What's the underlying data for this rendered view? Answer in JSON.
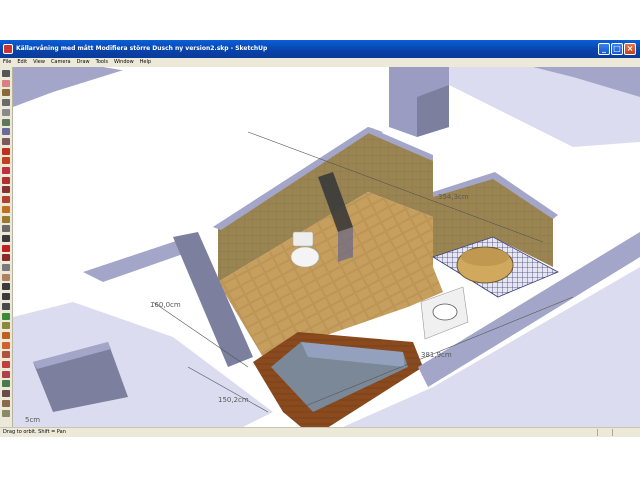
{
  "window": {
    "title": "Källarvåning med mått Modifiera större Dusch ny version2.skp - SketchUp",
    "controls": {
      "minimize": "_",
      "maximize": "□",
      "close": "×"
    }
  },
  "menu": [
    "File",
    "Edit",
    "View",
    "Camera",
    "Draw",
    "Tools",
    "Window",
    "Help"
  ],
  "toolbar": {
    "tools": [
      {
        "name": "select-icon",
        "color": "#555555"
      },
      {
        "name": "eraser-icon",
        "color": "#d98080"
      },
      {
        "name": "rectangle-icon",
        "color": "#8a6a3a"
      },
      {
        "name": "line-icon",
        "color": "#6a6a6a"
      },
      {
        "name": "circle-icon",
        "color": "#8a8a8a"
      },
      {
        "name": "arc-icon",
        "color": "#5a7a5a"
      },
      {
        "name": "polygon-icon",
        "color": "#6a6a9a"
      },
      {
        "name": "freehand-icon",
        "color": "#7a5a5a"
      },
      {
        "name": "move-icon",
        "color": "#c03020"
      },
      {
        "name": "push-pull-icon",
        "color": "#c04020"
      },
      {
        "name": "rotate-icon",
        "color": "#c03040"
      },
      {
        "name": "follow-me-icon",
        "color": "#b03030"
      },
      {
        "name": "scale-icon",
        "color": "#8a3030"
      },
      {
        "name": "offset-icon",
        "color": "#b04030"
      },
      {
        "name": "tape-measure-icon",
        "color": "#c07020"
      },
      {
        "name": "dimension-icon",
        "color": "#9a7a30"
      },
      {
        "name": "protractor-icon",
        "color": "#6a6a6a"
      },
      {
        "name": "text-icon",
        "color": "#3a3a3a"
      },
      {
        "name": "axes-icon",
        "color": "#c02020"
      },
      {
        "name": "3d-text-icon",
        "color": "#8a2a2a"
      },
      {
        "name": "orbit-icon",
        "color": "#7a7a7a"
      },
      {
        "name": "pan-icon",
        "color": "#b08060"
      },
      {
        "name": "zoom-icon",
        "color": "#3a3a3a"
      },
      {
        "name": "zoom-window-icon",
        "color": "#3a3a3a"
      },
      {
        "name": "zoom-extents-icon",
        "color": "#4a4a4a"
      },
      {
        "name": "previous-view-icon",
        "color": "#3a8a3a"
      },
      {
        "name": "next-view-icon",
        "color": "#8a8a3a"
      },
      {
        "name": "position-camera-icon",
        "color": "#c06020"
      },
      {
        "name": "walk-icon",
        "color": "#d06030"
      },
      {
        "name": "look-around-icon",
        "color": "#b05040"
      },
      {
        "name": "section-plane-icon",
        "color": "#c04040"
      },
      {
        "name": "paint-bucket-icon",
        "color": "#b04050"
      },
      {
        "name": "components-icon",
        "color": "#4a7a4a"
      },
      {
        "name": "materials-icon",
        "color": "#6a4a4a"
      },
      {
        "name": "styles-icon",
        "color": "#8a6a4a"
      },
      {
        "name": "layers-icon",
        "color": "#8a8a6a"
      }
    ]
  },
  "viewport": {
    "dimensions": {
      "d1": "354,3cm",
      "d2": "160,0cm",
      "d3": "381,9cm",
      "d4": "150,2cm",
      "d5": "5cm"
    },
    "colors": {
      "floor": "#c9a464",
      "wall_tile": "#9a8452",
      "wall_top": "#a3a6c8",
      "wall_side": "#7c7f9e",
      "white_floor": "#dcdcf0",
      "bath_wood": "#8a4a1e",
      "bath_interior": "#7a8898",
      "shower_glass": "#3a3a3a",
      "shower_grate": "#555a8a"
    }
  },
  "status": {
    "hint": "Drag to orbit.  Shift = Pan"
  }
}
